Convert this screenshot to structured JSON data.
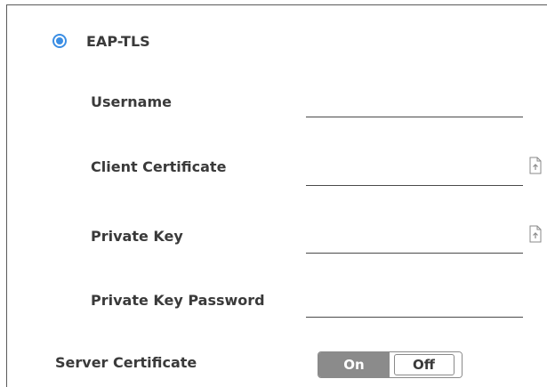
{
  "auth_option": {
    "label": "EAP-TLS",
    "selected": true,
    "accent_color": "#3b8ee4"
  },
  "fields": [
    {
      "label": "Username",
      "value": "",
      "has_upload": false
    },
    {
      "label": "Client Certificate",
      "value": "",
      "has_upload": true,
      "upload_icon": "file-upload-icon"
    },
    {
      "label": "Private Key",
      "value": "",
      "has_upload": true,
      "upload_icon": "file-upload-icon"
    },
    {
      "label": "Private Key Password",
      "value": "",
      "has_upload": false
    }
  ],
  "server_certificate": {
    "label": "Server Certificate",
    "on_label": "On",
    "off_label": "Off",
    "state": "On"
  }
}
